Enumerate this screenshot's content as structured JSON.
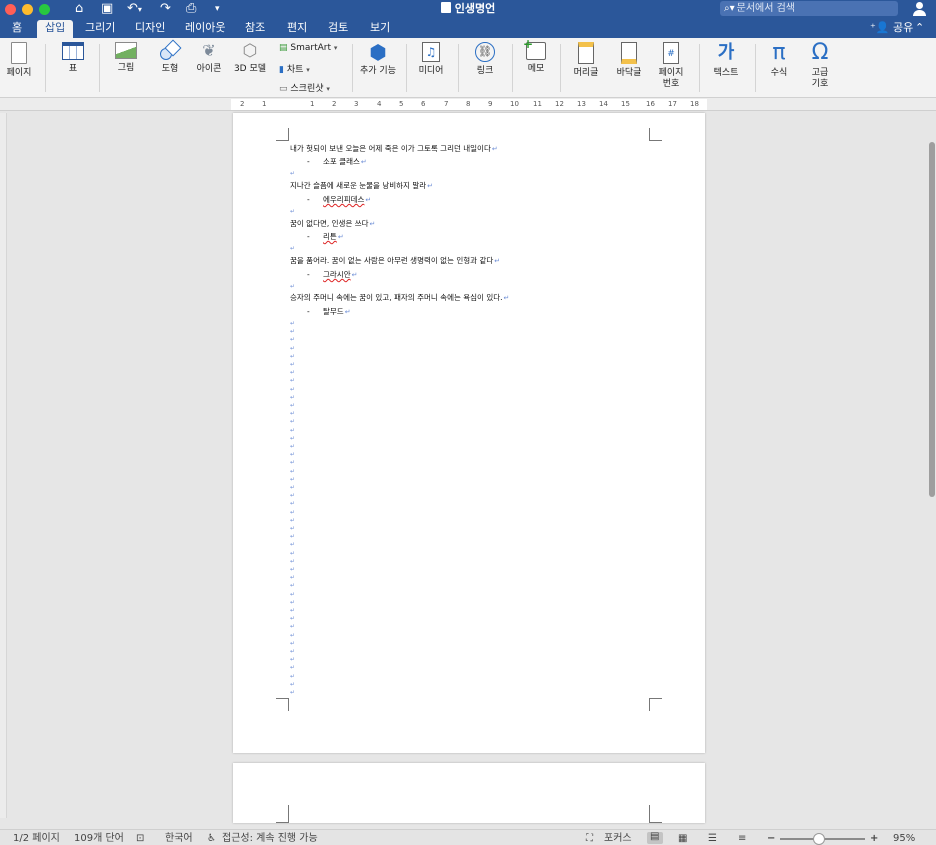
{
  "window": {
    "title": "인생명언",
    "search_placeholder": "문서에서 검색"
  },
  "tabs": [
    "홈",
    "삽입",
    "그리기",
    "디자인",
    "레이아웃",
    "참조",
    "편지",
    "검토",
    "보기"
  ],
  "active_tab": "삽입",
  "share_label": "공유",
  "ribbon": {
    "page": "페이지",
    "table": "표",
    "pictures": "그림",
    "shapes": "도형",
    "icons": "아이콘",
    "models3d": "3D 모델",
    "smartart": "SmartArt",
    "chart": "차트",
    "screenshot": "스크린샷",
    "addins": "추가 기능",
    "media": "미디어",
    "link": "링크",
    "comment": "메모",
    "header": "머리글",
    "footer": "바닥글",
    "page_number_l1": "페이지",
    "page_number_l2": "번호",
    "text": "텍스트",
    "equation": "수식",
    "symbol_l1": "고급",
    "symbol_l2": "기호"
  },
  "ruler_numbers": [
    "2",
    "1",
    "1",
    "2",
    "3",
    "4",
    "5",
    "6",
    "7",
    "8",
    "9",
    "10",
    "11",
    "12",
    "13",
    "14",
    "15",
    "16",
    "17",
    "18"
  ],
  "document": {
    "quotes": [
      {
        "text": "내가 헛되이 보낸 오늘은 어제 죽은 이가 그토록 그리던 내일이다",
        "author": "소포 클래스"
      },
      {
        "text": "지나간 슬픔에 새로운 눈물을 낭비하지 말라",
        "author": "에우리피데스"
      },
      {
        "text": "꿈이 없다면, 인생은 쓰다",
        "author": "리튼"
      },
      {
        "text": "꿈을 품어라. 꿈이 없는 사람은 아무런 생명력이 없는 인형과 같다",
        "author": "그라시안"
      },
      {
        "text": "승자의 주머니 속에는 꿈이 있고, 패자의 주머니 속에는 욕심이 있다.",
        "author": "탈무드"
      }
    ],
    "dash": "-"
  },
  "statusbar": {
    "page": "1/2 페이지",
    "words": "109개 단어",
    "language": "한국어",
    "accessibility": "접근성: 계속 진행 가능",
    "focus": "포커스",
    "zoom": "95%"
  },
  "colors": {
    "brand": "#2b579a",
    "ribbon_bg": "#f3f3f3",
    "workspace": "#e6e6e6"
  }
}
